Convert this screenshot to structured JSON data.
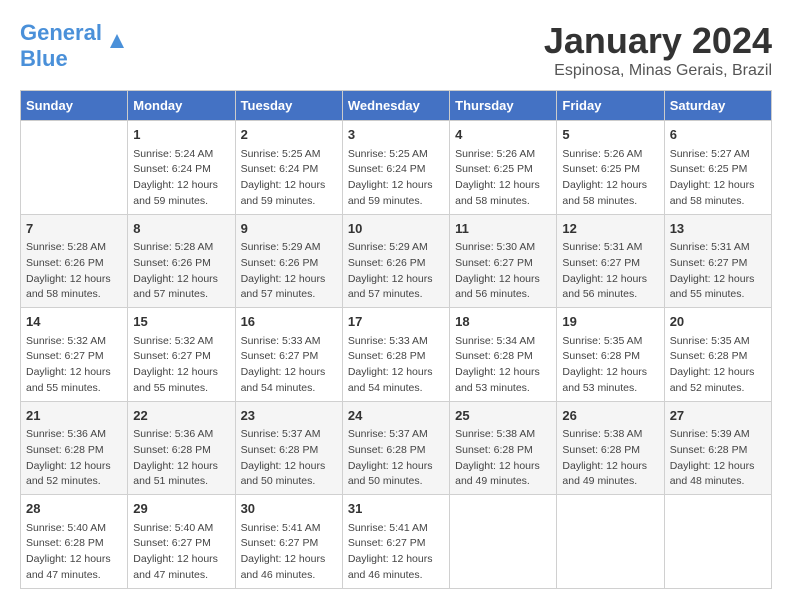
{
  "header": {
    "logo_text1": "General",
    "logo_text2": "Blue",
    "month_year": "January 2024",
    "location": "Espinosa, Minas Gerais, Brazil"
  },
  "days_of_week": [
    "Sunday",
    "Monday",
    "Tuesday",
    "Wednesday",
    "Thursday",
    "Friday",
    "Saturday"
  ],
  "weeks": [
    [
      {
        "day": "",
        "info": ""
      },
      {
        "day": "1",
        "info": "Sunrise: 5:24 AM\nSunset: 6:24 PM\nDaylight: 12 hours\nand 59 minutes."
      },
      {
        "day": "2",
        "info": "Sunrise: 5:25 AM\nSunset: 6:24 PM\nDaylight: 12 hours\nand 59 minutes."
      },
      {
        "day": "3",
        "info": "Sunrise: 5:25 AM\nSunset: 6:24 PM\nDaylight: 12 hours\nand 59 minutes."
      },
      {
        "day": "4",
        "info": "Sunrise: 5:26 AM\nSunset: 6:25 PM\nDaylight: 12 hours\nand 58 minutes."
      },
      {
        "day": "5",
        "info": "Sunrise: 5:26 AM\nSunset: 6:25 PM\nDaylight: 12 hours\nand 58 minutes."
      },
      {
        "day": "6",
        "info": "Sunrise: 5:27 AM\nSunset: 6:25 PM\nDaylight: 12 hours\nand 58 minutes."
      }
    ],
    [
      {
        "day": "7",
        "info": "Sunrise: 5:28 AM\nSunset: 6:26 PM\nDaylight: 12 hours\nand 58 minutes."
      },
      {
        "day": "8",
        "info": "Sunrise: 5:28 AM\nSunset: 6:26 PM\nDaylight: 12 hours\nand 57 minutes."
      },
      {
        "day": "9",
        "info": "Sunrise: 5:29 AM\nSunset: 6:26 PM\nDaylight: 12 hours\nand 57 minutes."
      },
      {
        "day": "10",
        "info": "Sunrise: 5:29 AM\nSunset: 6:26 PM\nDaylight: 12 hours\nand 57 minutes."
      },
      {
        "day": "11",
        "info": "Sunrise: 5:30 AM\nSunset: 6:27 PM\nDaylight: 12 hours\nand 56 minutes."
      },
      {
        "day": "12",
        "info": "Sunrise: 5:31 AM\nSunset: 6:27 PM\nDaylight: 12 hours\nand 56 minutes."
      },
      {
        "day": "13",
        "info": "Sunrise: 5:31 AM\nSunset: 6:27 PM\nDaylight: 12 hours\nand 55 minutes."
      }
    ],
    [
      {
        "day": "14",
        "info": "Sunrise: 5:32 AM\nSunset: 6:27 PM\nDaylight: 12 hours\nand 55 minutes."
      },
      {
        "day": "15",
        "info": "Sunrise: 5:32 AM\nSunset: 6:27 PM\nDaylight: 12 hours\nand 55 minutes."
      },
      {
        "day": "16",
        "info": "Sunrise: 5:33 AM\nSunset: 6:27 PM\nDaylight: 12 hours\nand 54 minutes."
      },
      {
        "day": "17",
        "info": "Sunrise: 5:33 AM\nSunset: 6:28 PM\nDaylight: 12 hours\nand 54 minutes."
      },
      {
        "day": "18",
        "info": "Sunrise: 5:34 AM\nSunset: 6:28 PM\nDaylight: 12 hours\nand 53 minutes."
      },
      {
        "day": "19",
        "info": "Sunrise: 5:35 AM\nSunset: 6:28 PM\nDaylight: 12 hours\nand 53 minutes."
      },
      {
        "day": "20",
        "info": "Sunrise: 5:35 AM\nSunset: 6:28 PM\nDaylight: 12 hours\nand 52 minutes."
      }
    ],
    [
      {
        "day": "21",
        "info": "Sunrise: 5:36 AM\nSunset: 6:28 PM\nDaylight: 12 hours\nand 52 minutes."
      },
      {
        "day": "22",
        "info": "Sunrise: 5:36 AM\nSunset: 6:28 PM\nDaylight: 12 hours\nand 51 minutes."
      },
      {
        "day": "23",
        "info": "Sunrise: 5:37 AM\nSunset: 6:28 PM\nDaylight: 12 hours\nand 50 minutes."
      },
      {
        "day": "24",
        "info": "Sunrise: 5:37 AM\nSunset: 6:28 PM\nDaylight: 12 hours\nand 50 minutes."
      },
      {
        "day": "25",
        "info": "Sunrise: 5:38 AM\nSunset: 6:28 PM\nDaylight: 12 hours\nand 49 minutes."
      },
      {
        "day": "26",
        "info": "Sunrise: 5:38 AM\nSunset: 6:28 PM\nDaylight: 12 hours\nand 49 minutes."
      },
      {
        "day": "27",
        "info": "Sunrise: 5:39 AM\nSunset: 6:28 PM\nDaylight: 12 hours\nand 48 minutes."
      }
    ],
    [
      {
        "day": "28",
        "info": "Sunrise: 5:40 AM\nSunset: 6:28 PM\nDaylight: 12 hours\nand 47 minutes."
      },
      {
        "day": "29",
        "info": "Sunrise: 5:40 AM\nSunset: 6:27 PM\nDaylight: 12 hours\nand 47 minutes."
      },
      {
        "day": "30",
        "info": "Sunrise: 5:41 AM\nSunset: 6:27 PM\nDaylight: 12 hours\nand 46 minutes."
      },
      {
        "day": "31",
        "info": "Sunrise: 5:41 AM\nSunset: 6:27 PM\nDaylight: 12 hours\nand 46 minutes."
      },
      {
        "day": "",
        "info": ""
      },
      {
        "day": "",
        "info": ""
      },
      {
        "day": "",
        "info": ""
      }
    ]
  ]
}
